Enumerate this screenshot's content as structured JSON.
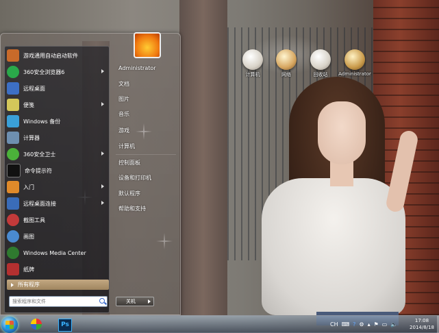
{
  "desktop": {
    "icons": [
      {
        "label": "计算机",
        "icon": "computer-icon"
      },
      {
        "label": "网络",
        "icon": "network-icon"
      },
      {
        "label": "回收站",
        "icon": "recycle-bin-icon"
      },
      {
        "label": "Administrator",
        "icon": "user-folder-icon"
      }
    ]
  },
  "start_menu": {
    "left_items": [
      {
        "label": "游戏通用自动启动软件",
        "icon": "game-launcher-icon",
        "color": "#c86a2a",
        "has_arrow": false
      },
      {
        "label": "360安全浏览器6",
        "icon": "360-browser-icon",
        "color": "#2aa84a",
        "has_arrow": true
      },
      {
        "label": "远程桌面",
        "icon": "remote-desktop-icon",
        "color": "#3d6fc4",
        "has_arrow": false
      },
      {
        "label": "便笺",
        "icon": "sticky-notes-icon",
        "color": "#d4c75a",
        "has_arrow": true
      },
      {
        "label": "Windows 备份",
        "icon": "backup-icon",
        "color": "#3aa0d8",
        "has_arrow": false
      },
      {
        "label": "计算器",
        "icon": "calculator-icon",
        "color": "#6e8fb0",
        "has_arrow": false
      },
      {
        "label": "360安全卫士",
        "icon": "360-security-icon",
        "color": "#4bb13a",
        "has_arrow": true
      },
      {
        "label": "命令提示符",
        "icon": "command-prompt-icon",
        "color": "#111111",
        "has_arrow": false
      },
      {
        "label": "入门",
        "icon": "getting-started-icon",
        "color": "#e08a2a",
        "has_arrow": true
      },
      {
        "label": "远程桌面连接",
        "icon": "remote-desktop-connection-icon",
        "color": "#3a6cb8",
        "has_arrow": true
      },
      {
        "label": "截图工具",
        "icon": "snipping-tool-icon",
        "color": "#c23a3a",
        "has_arrow": false
      },
      {
        "label": "画图",
        "icon": "paint-icon",
        "color": "#4a8ad0",
        "has_arrow": false
      },
      {
        "label": "Windows Media Center",
        "icon": "media-center-icon",
        "color": "#2f7a2f",
        "has_arrow": false
      },
      {
        "label": "纸牌",
        "icon": "solitaire-icon",
        "color": "#b43030",
        "has_arrow": false
      }
    ],
    "all_programs": "所有程序",
    "search_placeholder": "搜索程序和文件",
    "right_items": [
      "Administrator",
      "文档",
      "图片",
      "音乐",
      "游戏",
      "计算机",
      "控制面板",
      "设备和打印机",
      "默认程序",
      "帮助和支持"
    ],
    "shutdown_label": "关机"
  },
  "taskbar": {
    "apps": [
      {
        "name": "picasa-like-app-icon"
      },
      {
        "name": "photoshop-icon",
        "label": "Ps"
      }
    ],
    "tray": {
      "ime": "CH",
      "time": "17:08",
      "date": "2014/8/18"
    }
  }
}
